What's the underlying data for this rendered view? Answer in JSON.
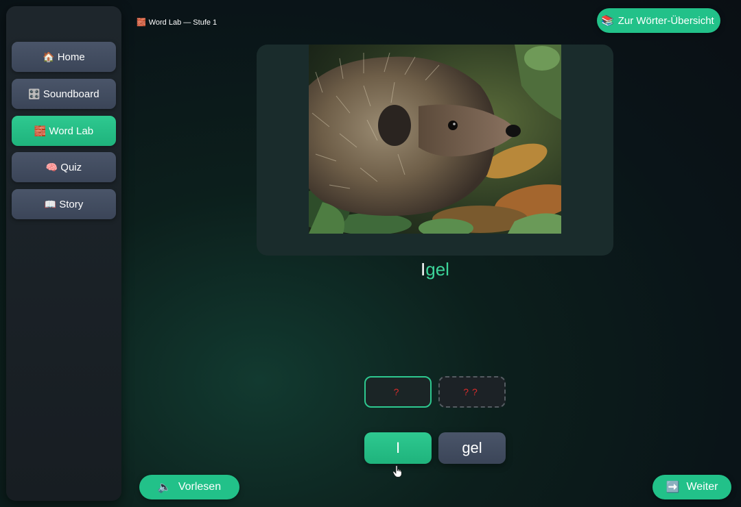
{
  "sidebar": {
    "items": [
      {
        "label": "Home",
        "icon": "🏠",
        "icon_name": "house-icon"
      },
      {
        "label": "Soundboard",
        "icon": "🎛️",
        "icon_name": "control-knobs-icon"
      },
      {
        "label": "Word Lab",
        "icon": "🧱",
        "icon_name": "bricks-icon",
        "active": true
      },
      {
        "label": "Quiz",
        "icon": "🧠",
        "icon_name": "brain-icon"
      },
      {
        "label": "Story",
        "icon": "📖",
        "icon_name": "book-icon"
      }
    ]
  },
  "header": {
    "breadcrumb_icon": "🧱",
    "breadcrumb": "Word Lab — Stufe 1",
    "overview_icon": "📚",
    "overview_label": "Zur Wörter-Übersicht"
  },
  "word": {
    "first": "I",
    "rest": "gel"
  },
  "slots": [
    "?",
    "??"
  ],
  "tiles": [
    "I",
    "gel"
  ],
  "footer": {
    "read_icon": "🔈",
    "read_label": "Vorlesen",
    "next_icon": "➡️",
    "next_label": "Weiter"
  },
  "colors": {
    "accent": "#22c189",
    "button_gray": "#4a5569",
    "slot_text": "#d92b2b",
    "word_rest": "#3dd59a"
  }
}
